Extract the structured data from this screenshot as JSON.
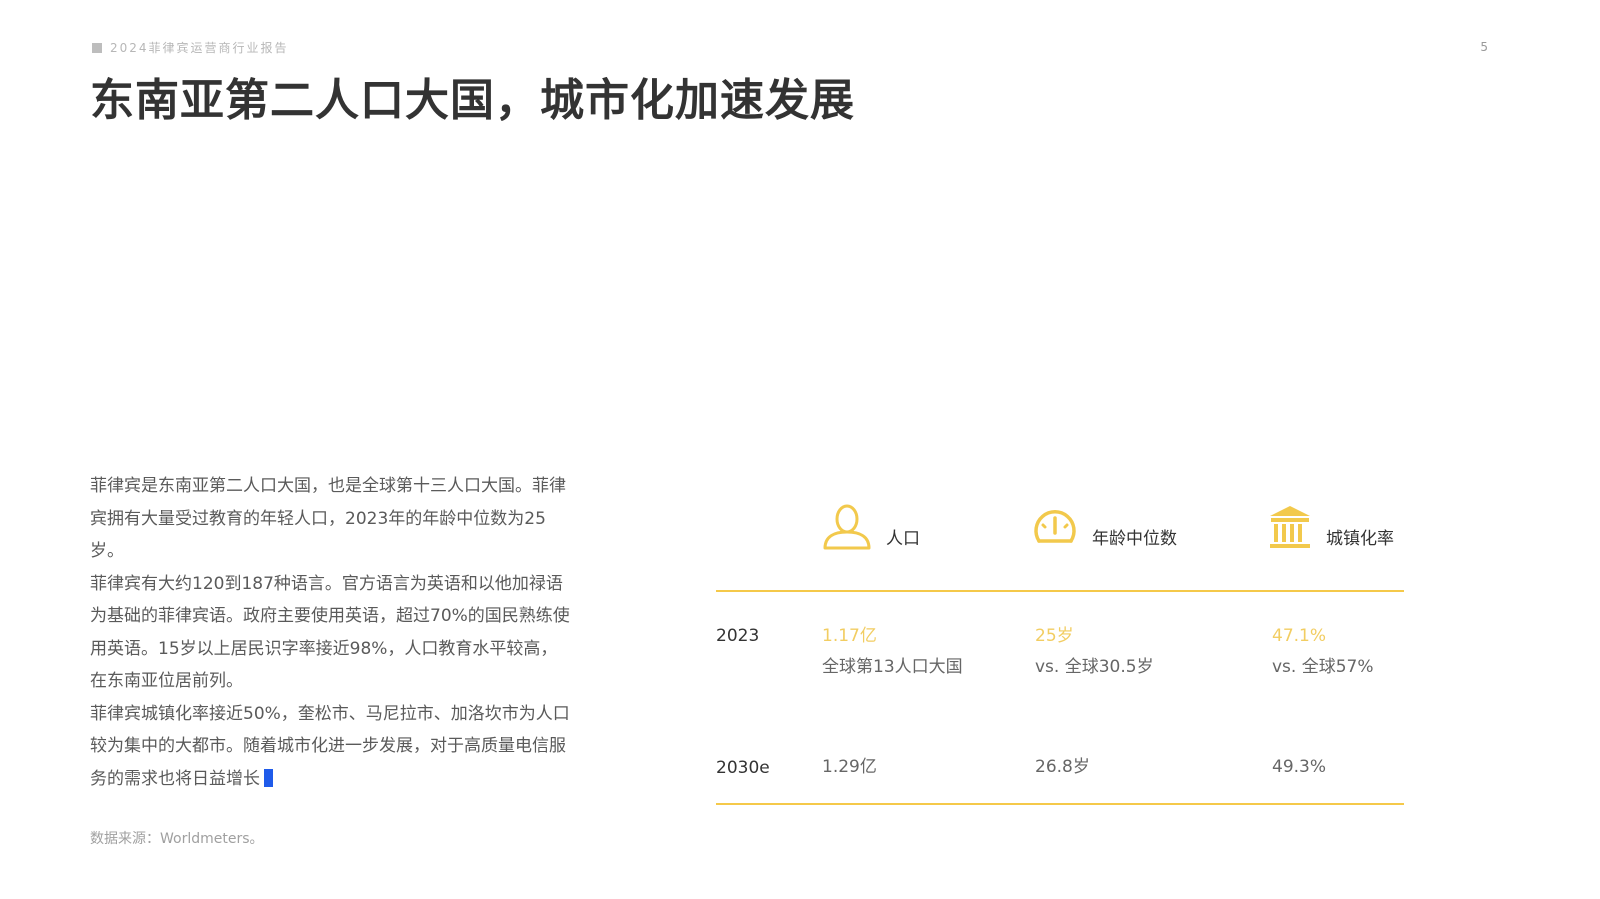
{
  "header": {
    "report_tag": "2024菲律宾运营商行业报告",
    "page_number": "5"
  },
  "title": "东南亚第二人口大国，城市化加速发展",
  "body": {
    "paragraphs": [
      "菲律宾是东南亚第二人口大国，也是全球第十三人口大国。菲律宾拥有大量受过教育的年轻人口，2023年的年龄中位数为25岁。",
      "菲律宾有大约120到187种语言。官方语言为英语和以他加禄语为基础的菲律宾语。政府主要使用英语，超过70%的国民熟练使用英语。15岁以上居民识字率接近98%，人口教育水平较高，在东南亚位居前列。",
      "菲律宾城镇化率接近50%，奎松市、马尼拉市、加洛坎市为人口较为集中的大都市。随着城市化进一步发展，对于高质量电信服务的需求也将日益增长"
    ]
  },
  "source_note": "数据来源：Worldmeters。",
  "stats_table": {
    "accent_color": "#f5c94a",
    "highlight_color": "#f2cd62",
    "columns": [
      {
        "label": "人口",
        "icon": "person-icon"
      },
      {
        "label": "年龄中位数",
        "icon": "gauge-icon"
      },
      {
        "label": "城镇化率",
        "icon": "bank-building-icon"
      }
    ],
    "rows": [
      {
        "year": "2023",
        "cells": [
          {
            "value": "1.17亿",
            "note": "全球第13人口大国"
          },
          {
            "value": "25岁",
            "note": "vs. 全球30.5岁"
          },
          {
            "value": "47.1%",
            "note": "vs. 全球57%"
          }
        ]
      },
      {
        "year": "2030e",
        "cells": [
          {
            "value": "1.29亿"
          },
          {
            "value": "26.8岁"
          },
          {
            "value": "49.3%"
          }
        ]
      }
    ]
  }
}
